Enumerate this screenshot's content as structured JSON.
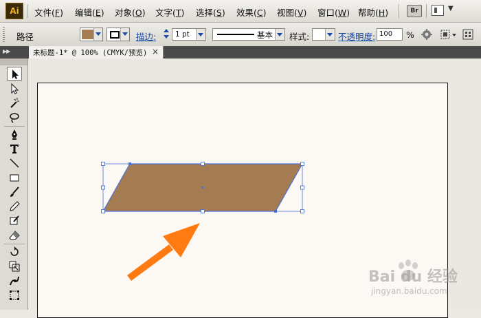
{
  "app": {
    "logo_text": "Ai"
  },
  "menu": [
    {
      "label": "文件(",
      "key": "F",
      "close": ")"
    },
    {
      "label": "编辑(",
      "key": "E",
      "close": ")"
    },
    {
      "label": "对象(",
      "key": "O",
      "close": ")"
    },
    {
      "label": "文字(",
      "key": "T",
      "close": ")"
    },
    {
      "label": "选择(",
      "key": "S",
      "close": ")"
    },
    {
      "label": "效果(",
      "key": "C",
      "close": ")"
    },
    {
      "label": "视图(",
      "key": "V",
      "close": ")"
    },
    {
      "label": "窗口(",
      "key": "W",
      "close": ")"
    },
    {
      "label": "帮助(",
      "key": "H",
      "close": ")"
    }
  ],
  "menubar_right": {
    "bridge_label": "Br"
  },
  "control": {
    "selection_label": "路径",
    "fill_color": "#a57b52",
    "stroke_color": "#000000",
    "stroke_link": "描边:",
    "stroke_weight": "1 pt",
    "profile_label": "基本",
    "style_label": "样式:",
    "opacity_link": "不透明度:",
    "opacity_value": "100",
    "opacity_unit": "%"
  },
  "document_tab": {
    "title": "未标题-1* @ 100% (CMYK/预览)",
    "close": "×"
  },
  "tools": [
    "selection-tool",
    "direct-selection-tool",
    "magic-wand-tool",
    "lasso-tool",
    "pen-tool",
    "type-tool",
    "line-segment-tool",
    "rectangle-tool",
    "paintbrush-tool",
    "pencil-tool",
    "blob-brush-tool",
    "eraser-tool",
    "rotate-tool",
    "scale-tool",
    "warp-tool",
    "free-transform-tool"
  ],
  "artwork": {
    "shape": "parallelogram",
    "fill": "#a57b52",
    "stroke": "#4a6fd8",
    "arrow_color": "#ff7a10"
  },
  "watermark": {
    "brand": "Bai du 经验",
    "url": "jingyan.baidu.com"
  }
}
